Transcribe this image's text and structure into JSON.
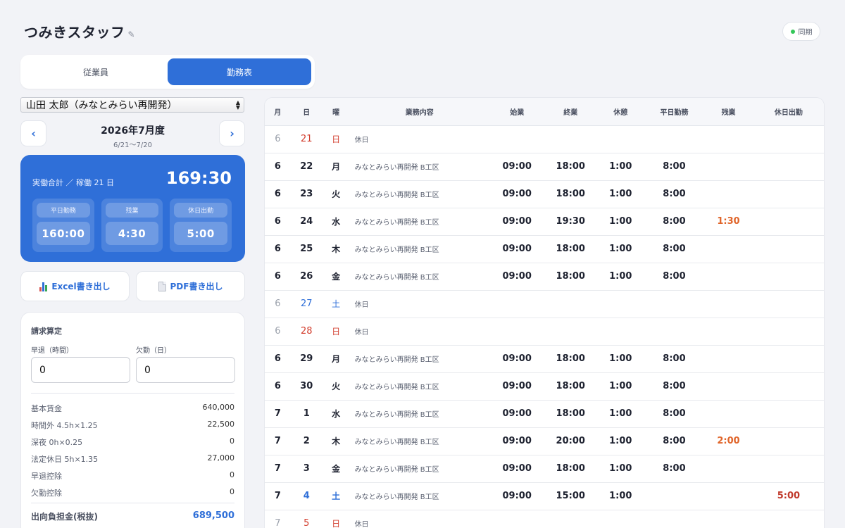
{
  "app": {
    "title": "つみきスタッフ",
    "edit_icon": "pencil-icon",
    "sync_label": "同期",
    "sync_color": "#34c759"
  },
  "tabs": [
    {
      "label": "従業員",
      "active": false
    },
    {
      "label": "勤務表",
      "active": true
    }
  ],
  "employee_select": {
    "value": "山田 太郎（みなとみらい再開発）"
  },
  "period": {
    "month": "2026年7月度",
    "range": "6/21〜7/20"
  },
  "summary": {
    "label": "実働合計 ／ 稼働 21 日",
    "total": "169:30",
    "boxes": [
      {
        "label": "平日勤務",
        "value": "160:00"
      },
      {
        "label": "残業",
        "value": "4:30"
      },
      {
        "label": "休日出勤",
        "value": "5:00"
      }
    ]
  },
  "export": {
    "excel_label": "Excel書き出し",
    "pdf_label": "PDF書き出し"
  },
  "billing": {
    "title": "請求算定",
    "early_leave_label": "早退（時間）",
    "early_leave_value": "0",
    "absence_label": "欠勤（日）",
    "absence_value": "0",
    "rows": [
      {
        "label": "基本賃金",
        "value": "640,000"
      },
      {
        "label": "時間外 4.5h×1.25",
        "value": "22,500"
      },
      {
        "label": "深夜 0h×0.25",
        "value": "0"
      },
      {
        "label": "法定休日 5h×1.35",
        "value": "27,000"
      },
      {
        "label": "早退控除",
        "value": "0"
      },
      {
        "label": "欠勤控除",
        "value": "0"
      }
    ],
    "total_label": "出向負担金(税抜)",
    "total_value": "689,500"
  },
  "table": {
    "headers": [
      "月",
      "日",
      "曜",
      "業務内容",
      "始業",
      "終業",
      "休憩",
      "平日勤務",
      "残業",
      "休日出勤"
    ],
    "rows": [
      {
        "month": "6",
        "day": "21",
        "dow": "日",
        "task": "休日",
        "start": "",
        "end": "",
        "break": "",
        "weekday": "",
        "overtime": "",
        "holiday_work": "",
        "type": "holiday",
        "color": "red"
      },
      {
        "month": "6",
        "day": "22",
        "dow": "月",
        "task": "みなとみらい再開発 B工区",
        "start": "09:00",
        "end": "18:00",
        "break": "1:00",
        "weekday": "8:00",
        "overtime": "",
        "holiday_work": "",
        "type": "work",
        "color": ""
      },
      {
        "month": "6",
        "day": "23",
        "dow": "火",
        "task": "みなとみらい再開発 B工区",
        "start": "09:00",
        "end": "18:00",
        "break": "1:00",
        "weekday": "8:00",
        "overtime": "",
        "holiday_work": "",
        "type": "work",
        "color": ""
      },
      {
        "month": "6",
        "day": "24",
        "dow": "水",
        "task": "みなとみらい再開発 B工区",
        "start": "09:00",
        "end": "19:30",
        "break": "1:00",
        "weekday": "8:00",
        "overtime": "1:30",
        "holiday_work": "",
        "type": "work",
        "color": ""
      },
      {
        "month": "6",
        "day": "25",
        "dow": "木",
        "task": "みなとみらい再開発 B工区",
        "start": "09:00",
        "end": "18:00",
        "break": "1:00",
        "weekday": "8:00",
        "overtime": "",
        "holiday_work": "",
        "type": "work",
        "color": ""
      },
      {
        "month": "6",
        "day": "26",
        "dow": "金",
        "task": "みなとみらい再開発 B工区",
        "start": "09:00",
        "end": "18:00",
        "break": "1:00",
        "weekday": "8:00",
        "overtime": "",
        "holiday_work": "",
        "type": "work",
        "color": ""
      },
      {
        "month": "6",
        "day": "27",
        "dow": "土",
        "task": "休日",
        "start": "",
        "end": "",
        "break": "",
        "weekday": "",
        "overtime": "",
        "holiday_work": "",
        "type": "holiday",
        "color": "blue"
      },
      {
        "month": "6",
        "day": "28",
        "dow": "日",
        "task": "休日",
        "start": "",
        "end": "",
        "break": "",
        "weekday": "",
        "overtime": "",
        "holiday_work": "",
        "type": "holiday",
        "color": "red"
      },
      {
        "month": "6",
        "day": "29",
        "dow": "月",
        "task": "みなとみらい再開発 B工区",
        "start": "09:00",
        "end": "18:00",
        "break": "1:00",
        "weekday": "8:00",
        "overtime": "",
        "holiday_work": "",
        "type": "work",
        "color": ""
      },
      {
        "month": "6",
        "day": "30",
        "dow": "火",
        "task": "みなとみらい再開発 B工区",
        "start": "09:00",
        "end": "18:00",
        "break": "1:00",
        "weekday": "8:00",
        "overtime": "",
        "holiday_work": "",
        "type": "work",
        "color": ""
      },
      {
        "month": "7",
        "day": "1",
        "dow": "水",
        "task": "みなとみらい再開発 B工区",
        "start": "09:00",
        "end": "18:00",
        "break": "1:00",
        "weekday": "8:00",
        "overtime": "",
        "holiday_work": "",
        "type": "work",
        "color": ""
      },
      {
        "month": "7",
        "day": "2",
        "dow": "木",
        "task": "みなとみらい再開発 B工区",
        "start": "09:00",
        "end": "20:00",
        "break": "1:00",
        "weekday": "8:00",
        "overtime": "2:00",
        "holiday_work": "",
        "type": "work",
        "color": ""
      },
      {
        "month": "7",
        "day": "3",
        "dow": "金",
        "task": "みなとみらい再開発 B工区",
        "start": "09:00",
        "end": "18:00",
        "break": "1:00",
        "weekday": "8:00",
        "overtime": "",
        "holiday_work": "",
        "type": "work",
        "color": ""
      },
      {
        "month": "7",
        "day": "4",
        "dow": "土",
        "task": "みなとみらい再開発 B工区",
        "start": "09:00",
        "end": "15:00",
        "break": "1:00",
        "weekday": "",
        "overtime": "",
        "holiday_work": "5:00",
        "type": "work",
        "color": "blue"
      },
      {
        "month": "7",
        "day": "5",
        "dow": "日",
        "task": "休日",
        "start": "",
        "end": "",
        "break": "",
        "weekday": "",
        "overtime": "",
        "holiday_work": "",
        "type": "holiday",
        "color": "red"
      }
    ]
  }
}
